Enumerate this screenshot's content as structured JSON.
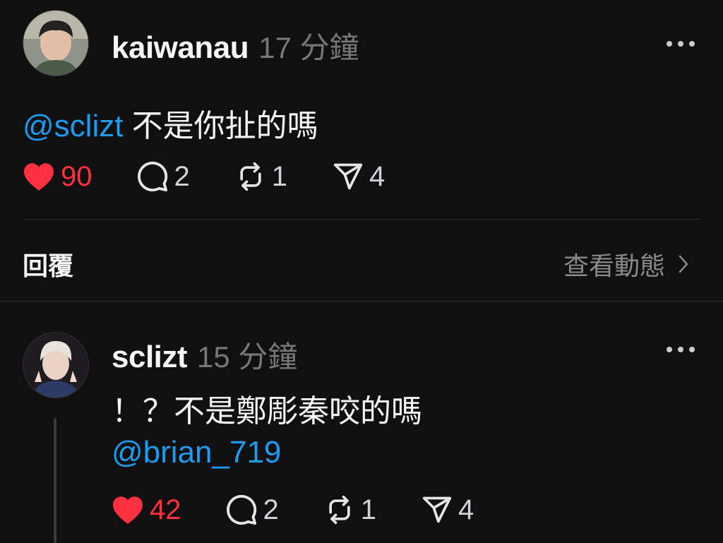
{
  "post": {
    "username": "kaiwanau",
    "time": "17 分鐘",
    "mention": "@sclizt",
    "text": " 不是你扯的嗎",
    "likes": "90",
    "comments": "2",
    "reposts": "1",
    "shares": "4"
  },
  "replies_bar": {
    "label": "回覆",
    "view_activity": "查看動態"
  },
  "reply": {
    "username": "sclizt",
    "time": "15 分鐘",
    "text": "！？不是鄭彫秦咬的嗎",
    "mention": "@brian_719",
    "likes": "42",
    "comments": "2",
    "reposts": "1",
    "shares": "4"
  },
  "colors": {
    "background": "#101010",
    "like_red": "#ff3040",
    "mention_blue": "#1d9bf0"
  },
  "icons": [
    "more-icon",
    "heart-icon",
    "comment-icon",
    "repost-icon",
    "share-icon",
    "chevron-right-icon"
  ]
}
